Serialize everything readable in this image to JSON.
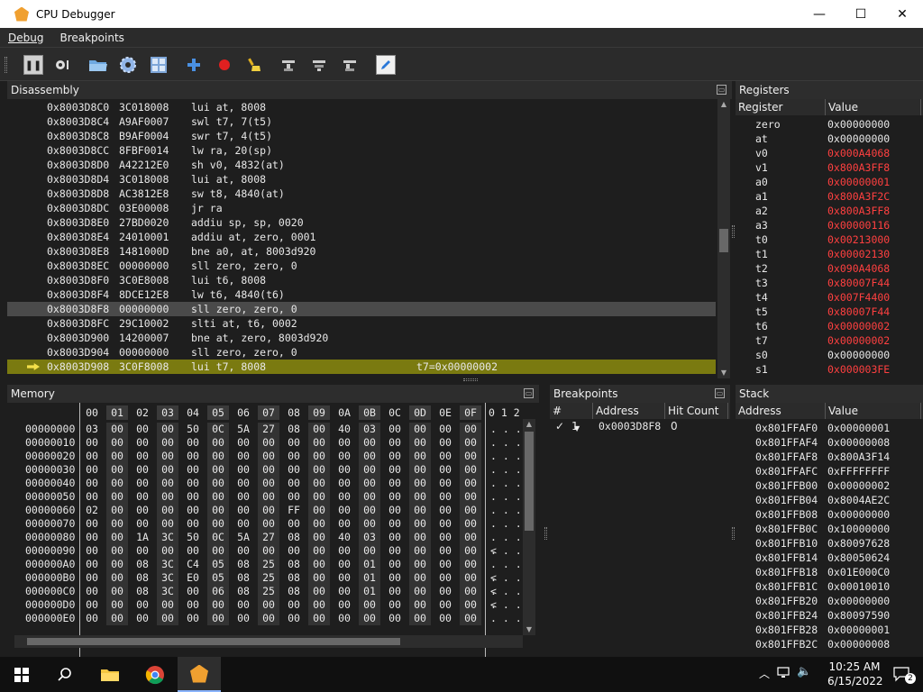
{
  "window": {
    "title": "CPU Debugger",
    "minimize": "—",
    "maximize": "☐",
    "close": "✕"
  },
  "menu": [
    "Debug",
    "Breakpoints"
  ],
  "toolbar": {
    "icons": [
      "pause-icon",
      "step-config-icon",
      "open-folder-icon",
      "settings-gear-icon",
      "grid-view-icon",
      "add-icon",
      "record-breakpoint-icon",
      "clear-broom-icon",
      "step-into-icon",
      "step-over-icon",
      "step-out-icon",
      "edit-pencil-icon"
    ],
    "pause_label": "❚❚"
  },
  "disassembly": {
    "title": "Disassembly",
    "rows": [
      {
        "addr": "0x8003D8C0",
        "op": "3C018008",
        "ins": "lui at, 8008",
        "cmt": ""
      },
      {
        "addr": "0x8003D8C4",
        "op": "A9AF0007",
        "ins": "swl t7, 7(t5)",
        "cmt": ""
      },
      {
        "addr": "0x8003D8C8",
        "op": "B9AF0004",
        "ins": "swr t7, 4(t5)",
        "cmt": ""
      },
      {
        "addr": "0x8003D8CC",
        "op": "8FBF0014",
        "ins": "lw ra, 20(sp)",
        "cmt": ""
      },
      {
        "addr": "0x8003D8D0",
        "op": "A42212E0",
        "ins": "sh v0, 4832(at)",
        "cmt": ""
      },
      {
        "addr": "0x8003D8D4",
        "op": "3C018008",
        "ins": "lui at, 8008",
        "cmt": ""
      },
      {
        "addr": "0x8003D8D8",
        "op": "AC3812E8",
        "ins": "sw t8, 4840(at)",
        "cmt": ""
      },
      {
        "addr": "0x8003D8DC",
        "op": "03E00008",
        "ins": "jr ra",
        "cmt": ""
      },
      {
        "addr": "0x8003D8E0",
        "op": "27BD0020",
        "ins": "addiu sp, sp, 0020",
        "cmt": ""
      },
      {
        "addr": "0x8003D8E4",
        "op": "24010001",
        "ins": "addiu at, zero, 0001",
        "cmt": ""
      },
      {
        "addr": "0x8003D8E8",
        "op": "1481000D",
        "ins": "bne a0, at, 8003d920",
        "cmt": ""
      },
      {
        "addr": "0x8003D8EC",
        "op": "00000000",
        "ins": "sll zero, zero, 0",
        "cmt": ""
      },
      {
        "addr": "0x8003D8F0",
        "op": "3C0E8008",
        "ins": "lui t6, 8008",
        "cmt": ""
      },
      {
        "addr": "0x8003D8F4",
        "op": "8DCE12E8",
        "ins": "lw t6, 4840(t6)",
        "cmt": ""
      },
      {
        "addr": "0x8003D8F8",
        "op": "00000000",
        "ins": "sll zero, zero, 0",
        "cmt": "",
        "state": "sel"
      },
      {
        "addr": "0x8003D8FC",
        "op": "29C10002",
        "ins": "slti at, t6, 0002",
        "cmt": ""
      },
      {
        "addr": "0x8003D900",
        "op": "14200007",
        "ins": "bne at, zero, 8003d920",
        "cmt": ""
      },
      {
        "addr": "0x8003D904",
        "op": "00000000",
        "ins": "sll zero, zero, 0",
        "cmt": ""
      },
      {
        "addr": "0x8003D908",
        "op": "3C0F8008",
        "ins": "lui t7, 8008",
        "cmt": "t7=0x00000002",
        "state": "cur"
      }
    ]
  },
  "registers": {
    "title": "Registers",
    "col_register": "Register",
    "col_value": "Value",
    "rows": [
      {
        "k": "zero",
        "v": "0x00000000",
        "changed": false
      },
      {
        "k": "at",
        "v": "0x00000000",
        "changed": false
      },
      {
        "k": "v0",
        "v": "0x000A4068",
        "changed": true
      },
      {
        "k": "v1",
        "v": "0x800A3FF8",
        "changed": true
      },
      {
        "k": "a0",
        "v": "0x00000001",
        "changed": true
      },
      {
        "k": "a1",
        "v": "0x800A3F2C",
        "changed": true
      },
      {
        "k": "a2",
        "v": "0x800A3FF8",
        "changed": true
      },
      {
        "k": "a3",
        "v": "0x00000116",
        "changed": true
      },
      {
        "k": "t0",
        "v": "0x00213000",
        "changed": true
      },
      {
        "k": "t1",
        "v": "0x00002130",
        "changed": true
      },
      {
        "k": "t2",
        "v": "0x090A4068",
        "changed": true
      },
      {
        "k": "t3",
        "v": "0x80007F44",
        "changed": true
      },
      {
        "k": "t4",
        "v": "0x007F4400",
        "changed": true
      },
      {
        "k": "t5",
        "v": "0x80007F44",
        "changed": true
      },
      {
        "k": "t6",
        "v": "0x00000002",
        "changed": true
      },
      {
        "k": "t7",
        "v": "0x00000002",
        "changed": true
      },
      {
        "k": "s0",
        "v": "0x00000000",
        "changed": false
      },
      {
        "k": "s1",
        "v": "0x000003FE",
        "changed": true
      }
    ]
  },
  "memory": {
    "title": "Memory",
    "columns": [
      "00",
      "01",
      "02",
      "03",
      "04",
      "05",
      "06",
      "07",
      "08",
      "09",
      "0A",
      "0B",
      "0C",
      "0D",
      "0E",
      "0F"
    ],
    "ascii_header": "0 1 2",
    "rows": [
      {
        "a": "00000000",
        "b": [
          "03",
          "00",
          "00",
          "00",
          "50",
          "0C",
          "5A",
          "27",
          "08",
          "00",
          "40",
          "03",
          "00",
          "00",
          "00",
          "00"
        ],
        "s": ". . ."
      },
      {
        "a": "00000010",
        "b": [
          "00",
          "00",
          "00",
          "00",
          "00",
          "00",
          "00",
          "00",
          "00",
          "00",
          "00",
          "00",
          "00",
          "00",
          "00",
          "00"
        ],
        "s": ". . ."
      },
      {
        "a": "00000020",
        "b": [
          "00",
          "00",
          "00",
          "00",
          "00",
          "00",
          "00",
          "00",
          "00",
          "00",
          "00",
          "00",
          "00",
          "00",
          "00",
          "00"
        ],
        "s": ". . ."
      },
      {
        "a": "00000030",
        "b": [
          "00",
          "00",
          "00",
          "00",
          "00",
          "00",
          "00",
          "00",
          "00",
          "00",
          "00",
          "00",
          "00",
          "00",
          "00",
          "00"
        ],
        "s": ". . ."
      },
      {
        "a": "00000040",
        "b": [
          "00",
          "00",
          "00",
          "00",
          "00",
          "00",
          "00",
          "00",
          "00",
          "00",
          "00",
          "00",
          "00",
          "00",
          "00",
          "00"
        ],
        "s": ". . ."
      },
      {
        "a": "00000050",
        "b": [
          "00",
          "00",
          "00",
          "00",
          "00",
          "00",
          "00",
          "00",
          "00",
          "00",
          "00",
          "00",
          "00",
          "00",
          "00",
          "00"
        ],
        "s": ". . ."
      },
      {
        "a": "00000060",
        "b": [
          "02",
          "00",
          "00",
          "00",
          "00",
          "00",
          "00",
          "00",
          "FF",
          "00",
          "00",
          "00",
          "00",
          "00",
          "00",
          "00"
        ],
        "s": ". . ."
      },
      {
        "a": "00000070",
        "b": [
          "00",
          "00",
          "00",
          "00",
          "00",
          "00",
          "00",
          "00",
          "00",
          "00",
          "00",
          "00",
          "00",
          "00",
          "00",
          "00"
        ],
        "s": ". . ."
      },
      {
        "a": "00000080",
        "b": [
          "00",
          "00",
          "1A",
          "3C",
          "50",
          "0C",
          "5A",
          "27",
          "08",
          "00",
          "40",
          "03",
          "00",
          "00",
          "00",
          "00"
        ],
        "s": ". . . <"
      },
      {
        "a": "00000090",
        "b": [
          "00",
          "00",
          "00",
          "00",
          "00",
          "00",
          "00",
          "00",
          "00",
          "00",
          "00",
          "00",
          "00",
          "00",
          "00",
          "00"
        ],
        "s": ". . ."
      },
      {
        "a": "000000A0",
        "b": [
          "00",
          "00",
          "08",
          "3C",
          "C4",
          "05",
          "08",
          "25",
          "08",
          "00",
          "00",
          "01",
          "00",
          "00",
          "00",
          "00"
        ],
        "s": ". . . <"
      },
      {
        "a": "000000B0",
        "b": [
          "00",
          "00",
          "08",
          "3C",
          "E0",
          "05",
          "08",
          "25",
          "08",
          "00",
          "00",
          "01",
          "00",
          "00",
          "00",
          "00"
        ],
        "s": ". . . <"
      },
      {
        "a": "000000C0",
        "b": [
          "00",
          "00",
          "08",
          "3C",
          "00",
          "06",
          "08",
          "25",
          "08",
          "00",
          "00",
          "01",
          "00",
          "00",
          "00",
          "00"
        ],
        "s": ". . . <"
      },
      {
        "a": "000000D0",
        "b": [
          "00",
          "00",
          "00",
          "00",
          "00",
          "00",
          "00",
          "00",
          "00",
          "00",
          "00",
          "00",
          "00",
          "00",
          "00",
          "00"
        ],
        "s": ". . ."
      },
      {
        "a": "000000E0",
        "b": [
          "00",
          "00",
          "00",
          "00",
          "00",
          "00",
          "00",
          "00",
          "00",
          "00",
          "00",
          "00",
          "00",
          "00",
          "00",
          "00"
        ],
        "s": ". . ."
      }
    ]
  },
  "breakpoints": {
    "title": "Breakpoints",
    "col_num": "#",
    "col_address": "Address",
    "col_hits": "Hit Count",
    "rows": [
      {
        "check": "✓",
        "num": "1",
        "address": "0x0003D8F8",
        "hits": "0"
      }
    ]
  },
  "stack": {
    "title": "Stack",
    "col_address": "Address",
    "col_value": "Value",
    "rows": [
      {
        "k": "0x801FFAF0",
        "v": "0x00000001"
      },
      {
        "k": "0x801FFAF4",
        "v": "0x00000008"
      },
      {
        "k": "0x801FFAF8",
        "v": "0x800A3F14"
      },
      {
        "k": "0x801FFAFC",
        "v": "0xFFFFFFFF"
      },
      {
        "k": "0x801FFB00",
        "v": "0x00000002"
      },
      {
        "k": "0x801FFB04",
        "v": "0x8004AE2C"
      },
      {
        "k": "0x801FFB08",
        "v": "0x00000000"
      },
      {
        "k": "0x801FFB0C",
        "v": "0x10000000"
      },
      {
        "k": "0x801FFB10",
        "v": "0x80097628"
      },
      {
        "k": "0x801FFB14",
        "v": "0x80050624"
      },
      {
        "k": "0x801FFB18",
        "v": "0x01E000C0"
      },
      {
        "k": "0x801FFB1C",
        "v": "0x00010010"
      },
      {
        "k": "0x801FFB20",
        "v": "0x00000000"
      },
      {
        "k": "0x801FFB24",
        "v": "0x80097590"
      },
      {
        "k": "0x801FFB28",
        "v": "0x00000001"
      },
      {
        "k": "0x801FFB2C",
        "v": "0x00000008"
      }
    ]
  },
  "taskbar": {
    "time": "10:25 AM",
    "date": "6/15/2022",
    "notifications": "2",
    "icons": [
      "windows-start-icon",
      "search-icon",
      "file-explorer-icon",
      "chrome-icon",
      "debugger-app-icon"
    ],
    "tray_icons": [
      "chevron-up-icon",
      "network-icon",
      "volume-icon"
    ]
  }
}
